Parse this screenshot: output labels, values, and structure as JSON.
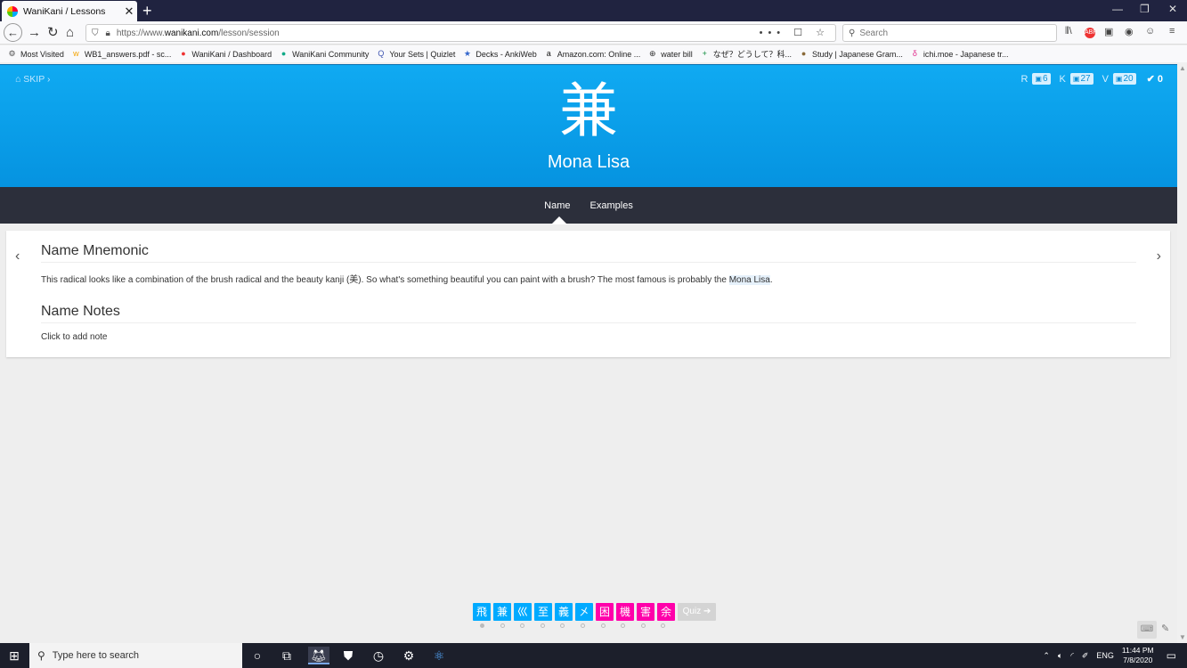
{
  "browser": {
    "tab_title": "WaniKani / Lessons",
    "tab_close": "✕",
    "new_tab": "+",
    "url_prefix": "https://www.",
    "url_domain": "wanikani.com",
    "url_path": "/lesson/session",
    "url_actions": "••• ☐ ☆",
    "search_placeholder": "Search",
    "window_controls": [
      "—",
      "❐",
      "✕"
    ],
    "toolbar_icons": [
      "⫴\\",
      "ABP",
      "▣",
      "◉",
      "☺",
      "≡"
    ],
    "bookmarks": [
      {
        "label": "Most Visited",
        "icon": "⚙",
        "color": "#555"
      },
      {
        "label": "WB1_answers.pdf - sc...",
        "icon": "w",
        "color": "#f4a300"
      },
      {
        "label": "WaniKani / Dashboard",
        "icon": "●",
        "color": "#e33"
      },
      {
        "label": "WaniKani Community",
        "icon": "●",
        "color": "#1a8"
      },
      {
        "label": "Your Sets | Quizlet",
        "icon": "Q",
        "color": "#4257b2"
      },
      {
        "label": "Decks - AnkiWeb",
        "icon": "★",
        "color": "#3366cc"
      },
      {
        "label": "Amazon.com: Online ...",
        "icon": "a",
        "color": "#111"
      },
      {
        "label": "water bill",
        "icon": "⊕",
        "color": "#333"
      },
      {
        "label": "なぜ？どうして？科...",
        "icon": "+",
        "color": "#0a8a3a"
      },
      {
        "label": "Study | Japanese Gram...",
        "icon": "●",
        "color": "#8a6a3a"
      },
      {
        "label": "ichi.moe - Japanese tr...",
        "icon": "δ",
        "color": "#e0288a"
      }
    ]
  },
  "lesson": {
    "skip_label": "SKIP",
    "stats": [
      {
        "key": "R",
        "count": "6"
      },
      {
        "key": "K",
        "count": "27"
      },
      {
        "key": "V",
        "count": "20"
      }
    ],
    "completed": "0",
    "character": "兼",
    "meaning": "Mona Lisa",
    "tabs": [
      "Name",
      "Examples"
    ],
    "active_tab": "Name",
    "mnemonic_heading": "Name Mnemonic",
    "mnemonic_text_before": "This radical looks like a combination of the brush radical and the beauty kanji (美). So what's something beautiful you can paint with a brush? The most famous is probably the ",
    "mnemonic_highlight": "Mona Lisa",
    "mnemonic_text_after": ".",
    "notes_heading": "Name Notes",
    "notes_placeholder": "Click to add note",
    "prev_arrow": "‹",
    "next_arrow": "›"
  },
  "queue": {
    "items": [
      {
        "char": "飛",
        "type": "radical"
      },
      {
        "char": "兼",
        "type": "radical"
      },
      {
        "char": "巛",
        "type": "radical"
      },
      {
        "char": "至",
        "type": "radical"
      },
      {
        "char": "義",
        "type": "radical"
      },
      {
        "char": "㐅",
        "type": "radical"
      },
      {
        "char": "困",
        "type": "kanji"
      },
      {
        "char": "機",
        "type": "kanji"
      },
      {
        "char": "害",
        "type": "kanji"
      },
      {
        "char": "余",
        "type": "kanji"
      }
    ],
    "quiz_label": "Quiz ➔",
    "dot_count": 10,
    "active_dot": 0
  },
  "colors": {
    "radical": "#00aaff",
    "kanji": "#ff00aa",
    "header_blue": "#0593e0",
    "subnav": "#2c2f3b"
  },
  "taskbar": {
    "search_placeholder": "Type here to search",
    "language": "ENG",
    "time": "11:44 PM",
    "date": "7/8/2020"
  }
}
